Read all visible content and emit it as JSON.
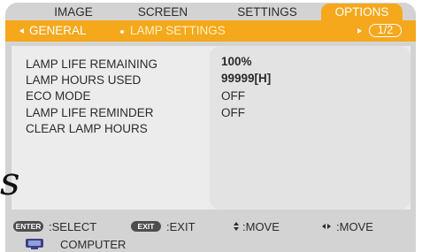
{
  "tabs": [
    {
      "label": "IMAGE"
    },
    {
      "label": "SCREEN"
    },
    {
      "label": "SETTINGS"
    },
    {
      "label": "OPTIONS"
    }
  ],
  "subtabs": {
    "prev": "GENERAL",
    "current": "LAMP SETTINGS",
    "page": "1/2"
  },
  "rows": [
    {
      "label": "LAMP LIFE REMAINING",
      "value": "100%"
    },
    {
      "label": "LAMP HOURS USED",
      "value": "99999[H]"
    },
    {
      "label": "ECO MODE",
      "value": "OFF"
    },
    {
      "label": "LAMP LIFE REMINDER",
      "value": "OFF"
    },
    {
      "label": "CLEAR LAMP HOURS",
      "value": ""
    }
  ],
  "stray_text": "s",
  "hints": {
    "enter_key": "ENTER",
    "enter_label": ":SELECT",
    "exit_key": "EXIT",
    "exit_label": ":EXIT",
    "move_vertical": ":MOVE",
    "move_horizontal": ":MOVE"
  },
  "source": "COMPUTER",
  "colors": {
    "accent": "#f5a81c",
    "panel": "#d3d3d3",
    "key": "#4d4d4d"
  }
}
